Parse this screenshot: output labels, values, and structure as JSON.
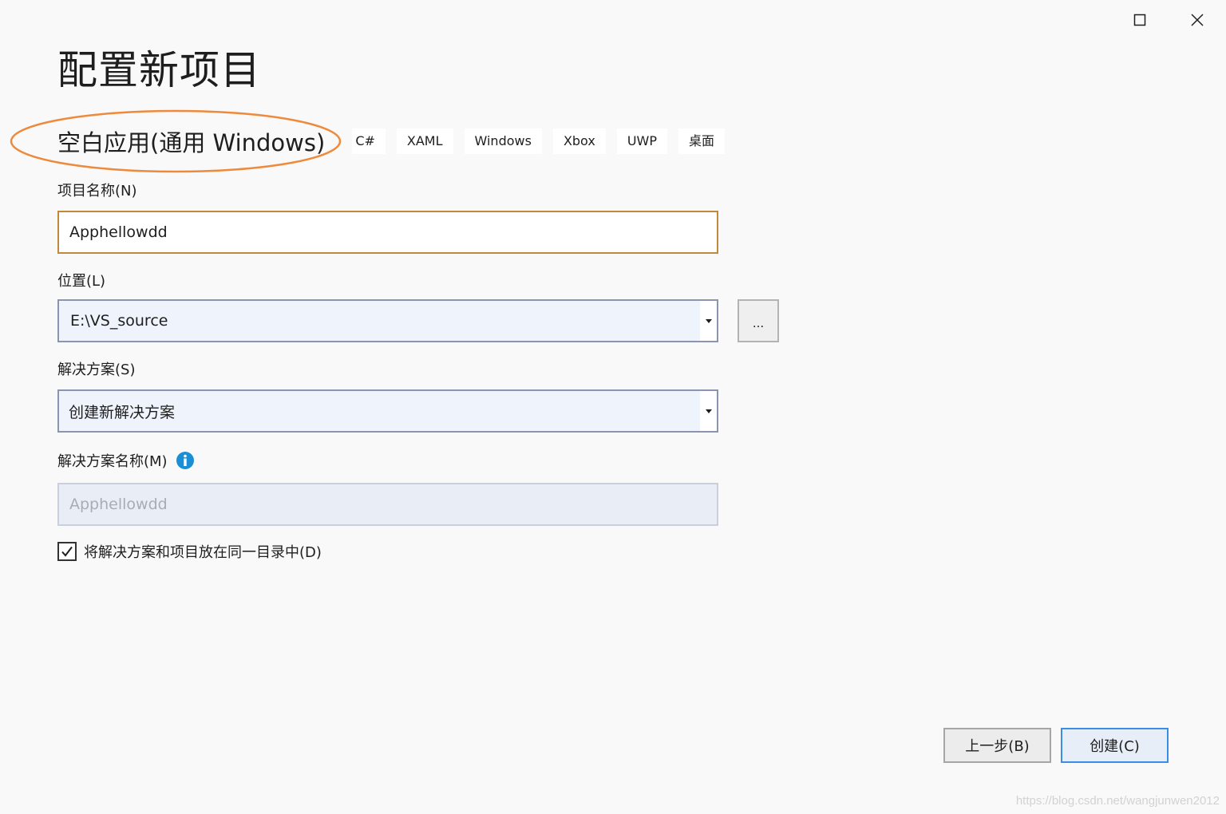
{
  "window": {
    "maximize_icon": "maximize-icon",
    "close_icon": "close-icon"
  },
  "page": {
    "title": "配置新项目"
  },
  "template": {
    "name": "空白应用(通用 Windows)",
    "tags": [
      "C#",
      "XAML",
      "Windows",
      "Xbox",
      "UWP",
      "桌面"
    ]
  },
  "project_name": {
    "label": "项目名称(N)",
    "value": "Apphellowdd"
  },
  "location": {
    "label": "位置(L)",
    "value": "E:\\VS_source",
    "browse_label": "..."
  },
  "solution": {
    "label": "解决方案(S)",
    "value": "创建新解决方案"
  },
  "solution_name": {
    "label": "解决方案名称(M)",
    "value": "Apphellowdd",
    "info_icon": "info-icon"
  },
  "same_directory": {
    "label": "将解决方案和项目放在同一目录中(D)",
    "checked": true
  },
  "buttons": {
    "back": "上一步(B)",
    "create": "创建(C)"
  },
  "watermark": "https://blog.csdn.net/wangjunwen2012",
  "colors": {
    "annotation_ellipse": "#ee8a3c",
    "focus_border": "#c08a3a",
    "primary_border": "#3a8ee6",
    "info_icon": "#1b8fd6"
  }
}
